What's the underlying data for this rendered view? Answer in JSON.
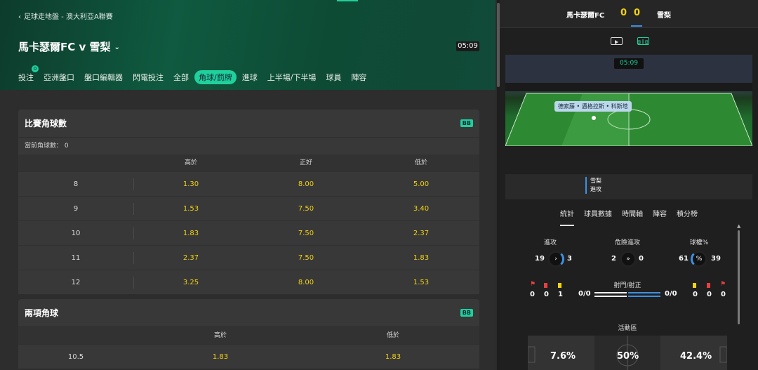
{
  "header": {
    "breadcrumb": "足球走地盤 - 澳大利亞A聯賽",
    "match_title": "馬卡瑟爾FC v 雪梨",
    "clock": "05:09"
  },
  "tabs": [
    {
      "label": "投注",
      "badge": "0"
    },
    {
      "label": "亞洲盤口"
    },
    {
      "label": "盤口編輯器"
    },
    {
      "label": "閃電投注"
    },
    {
      "label": "全部"
    },
    {
      "label": "角球/罰牌"
    },
    {
      "label": "進球"
    },
    {
      "label": "上半場/下半場"
    },
    {
      "label": "球員"
    },
    {
      "label": "陣容"
    }
  ],
  "markets": {
    "total_corners": {
      "title": "比賽角球數",
      "tag": "BB",
      "current": "當前角球數： 0",
      "cols": [
        "高於",
        "正好",
        "低於"
      ],
      "rows": [
        {
          "line": "8",
          "odds": [
            "1.30",
            "8.00",
            "5.00"
          ]
        },
        {
          "line": "9",
          "odds": [
            "1.53",
            "7.50",
            "3.40"
          ]
        },
        {
          "line": "10",
          "odds": [
            "1.83",
            "7.50",
            "2.37"
          ]
        },
        {
          "line": "11",
          "odds": [
            "2.37",
            "7.50",
            "1.83"
          ]
        },
        {
          "line": "12",
          "odds": [
            "3.25",
            "8.00",
            "1.53"
          ]
        }
      ]
    },
    "two_way_corners": {
      "title": "兩項角球",
      "tag": "BB",
      "cols": [
        "高於",
        "低於"
      ],
      "rows": [
        {
          "line": "10.5",
          "odds": [
            "1.83",
            "1.83"
          ]
        }
      ]
    }
  },
  "scoreboard": {
    "home": "馬卡瑟爾FC",
    "away": "雪梨",
    "home_score": "0",
    "away_score": "0"
  },
  "pitch": {
    "clock": "05:09",
    "caption": "德索藤 • 邁格拉斯 • 科斯塔",
    "event_team": "雪梨",
    "event_type": "進攻"
  },
  "subnav": [
    "統計",
    "球員數據",
    "時間軸",
    "陣容",
    "積分榜"
  ],
  "stats": {
    "attacks": {
      "label": "進攻",
      "home": "19",
      "away": "3"
    },
    "dangerous": {
      "label": "危險進攻",
      "home": "2",
      "away": "0"
    },
    "possession": {
      "label": "球權%",
      "home": "61",
      "away": "39"
    },
    "shots": {
      "label": "射門/射正",
      "home": "0/0",
      "away": "0/0"
    },
    "cards_home": [
      "0",
      "0",
      "1"
    ],
    "cards_away": [
      "0",
      "0",
      "0"
    ],
    "activity": {
      "label": "活動區",
      "left": "7.6%",
      "mid": "50%",
      "right": "42.4%"
    }
  },
  "colors": {
    "accent": "#1fd19b",
    "odds": "#f2d211",
    "away": "#3f8fe0"
  }
}
